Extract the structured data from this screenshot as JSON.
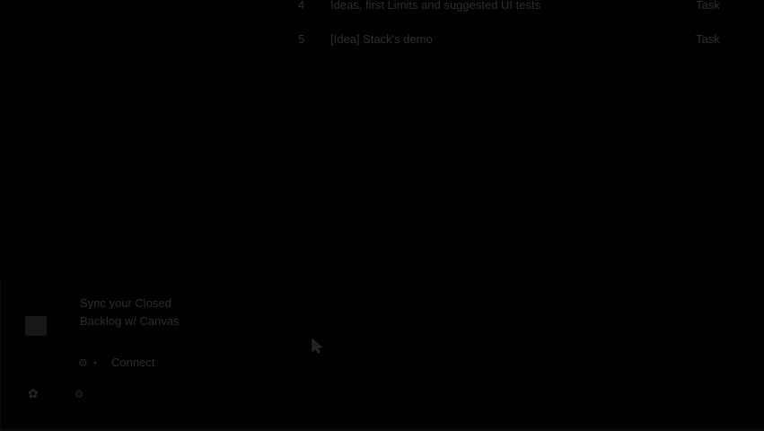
{
  "backlog": {
    "rows": [
      {
        "index": "4",
        "name": "Ideas, first Limits and suggested UI tests",
        "type": "Task"
      },
      {
        "index": "5",
        "name": "[Idea] Stack's demo",
        "type": "Task"
      }
    ]
  },
  "sidebar": {
    "sync": {
      "icon": "github-icon",
      "text": "Sync your Closed Backlog w/ Canvas"
    },
    "connect": {
      "glyph": "⚙",
      "dot": "•",
      "label": "Connect"
    },
    "bottom": {
      "glyph": "✿",
      "text": "⚙"
    }
  },
  "colors": {
    "background": "#010101",
    "text_dim": "#2c2c2c"
  }
}
